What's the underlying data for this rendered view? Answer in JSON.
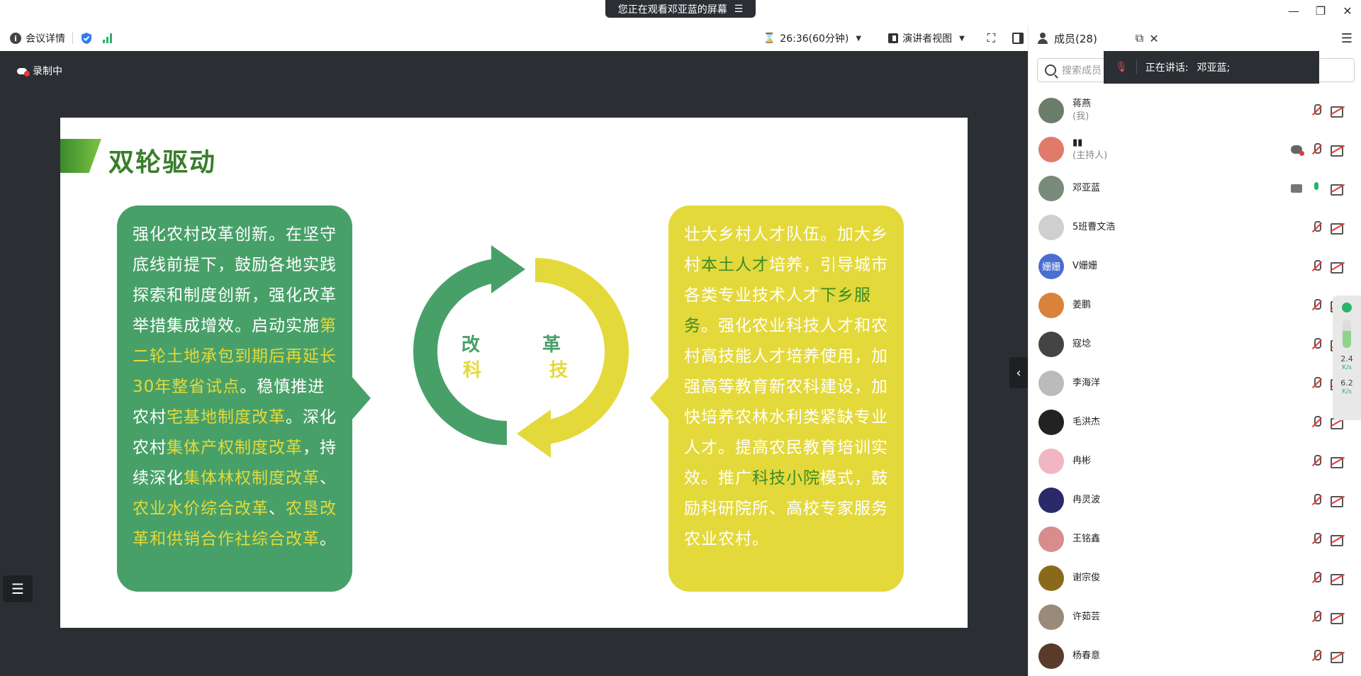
{
  "banner": {
    "text": "您正在观看邓亚蓝的屏幕"
  },
  "window": {
    "minimize": "—",
    "restore": "❐",
    "close": "✕"
  },
  "toolbar": {
    "meeting_details": "会议详情",
    "timer": "26:36(60分钟)",
    "presenter_view": "演讲者视图"
  },
  "stage": {
    "recording": "录制中",
    "slide": {
      "title": "双轮驱动",
      "cycle": {
        "gai": "改",
        "ge": "革",
        "ke": "科",
        "ji": "技"
      },
      "left": {
        "t1": "强化农村改革创新。在坚守底线前提下，鼓励各地实践探索和制度创新，强化改革举措集成增效。启动实施",
        "h1": "第二轮土地承包到期后再延长30年整省试点",
        "t2": "。稳慎推进农村",
        "h2": "宅基地制度改革",
        "t3": "。深化农村",
        "h3": "集体产权制度改革",
        "t4": "，持续深化",
        "h4": "集体林权制度改革",
        "t5": "、",
        "h5": "农业水价综合改革",
        "t6": "、",
        "h6": "农垦改革和供销合作社综合改革",
        "t7": "。"
      },
      "right": {
        "t1": "壮大乡村人才队伍。加大乡村",
        "h1": "本土人才",
        "t2": "培养，引导城市各类专业技术人才",
        "h2": "下乡服务",
        "t3": "。强化农业科技人才和农村高技能人才培养使用，加强高等教育新农科建设，加快培养农林水利类紧缺专业人才。提高农民教育培训实效。推广",
        "h3": "科技小院",
        "t4": "模式，鼓励科研院所、高校专家服务农业农村。"
      }
    }
  },
  "panel": {
    "title": "成员(28)",
    "search_placeholder": "搜索成员",
    "speaking_label": "正在讲话:",
    "speaking_name": "邓亚蓝;",
    "members": [
      {
        "name": "蒋燕",
        "role": "(我)",
        "avatar_color": "#6a7d6a"
      },
      {
        "name": "▮▮",
        "role": "(主持人)",
        "avatar_color": "#e07a6a"
      },
      {
        "name": "邓亚蓝",
        "role": "",
        "avatar_color": "#7a8a7a"
      },
      {
        "name": "5班曹文浩",
        "role": "",
        "avatar_color": "#cfcfcf"
      },
      {
        "name": "V姗姗",
        "role": "",
        "avatar_color": "#4a6fd1",
        "avatar_text": "姗姗"
      },
      {
        "name": "姜鹏",
        "role": "",
        "avatar_color": "#d9823b"
      },
      {
        "name": "寇埝",
        "role": "",
        "avatar_color": "#444444"
      },
      {
        "name": "李海洋",
        "role": "",
        "avatar_color": "#bbbbbb"
      },
      {
        "name": "毛洪杰",
        "role": "",
        "avatar_color": "#222222"
      },
      {
        "name": "冉彬",
        "role": "",
        "avatar_color": "#f0b7c2"
      },
      {
        "name": "冉灵波",
        "role": "",
        "avatar_color": "#2a2a6a"
      },
      {
        "name": "王铭鑫",
        "role": "",
        "avatar_color": "#d98c8c"
      },
      {
        "name": "谢宗俊",
        "role": "",
        "avatar_color": "#8a6a1a"
      },
      {
        "name": "许茹芸",
        "role": "",
        "avatar_color": "#9a8a7a"
      },
      {
        "name": "杨春意",
        "role": "",
        "avatar_color": "#5a3a2a"
      }
    ]
  },
  "meter": {
    "up": "2.4",
    "up_unit": "K/s",
    "down": "6.2",
    "down_unit": "K/s"
  }
}
